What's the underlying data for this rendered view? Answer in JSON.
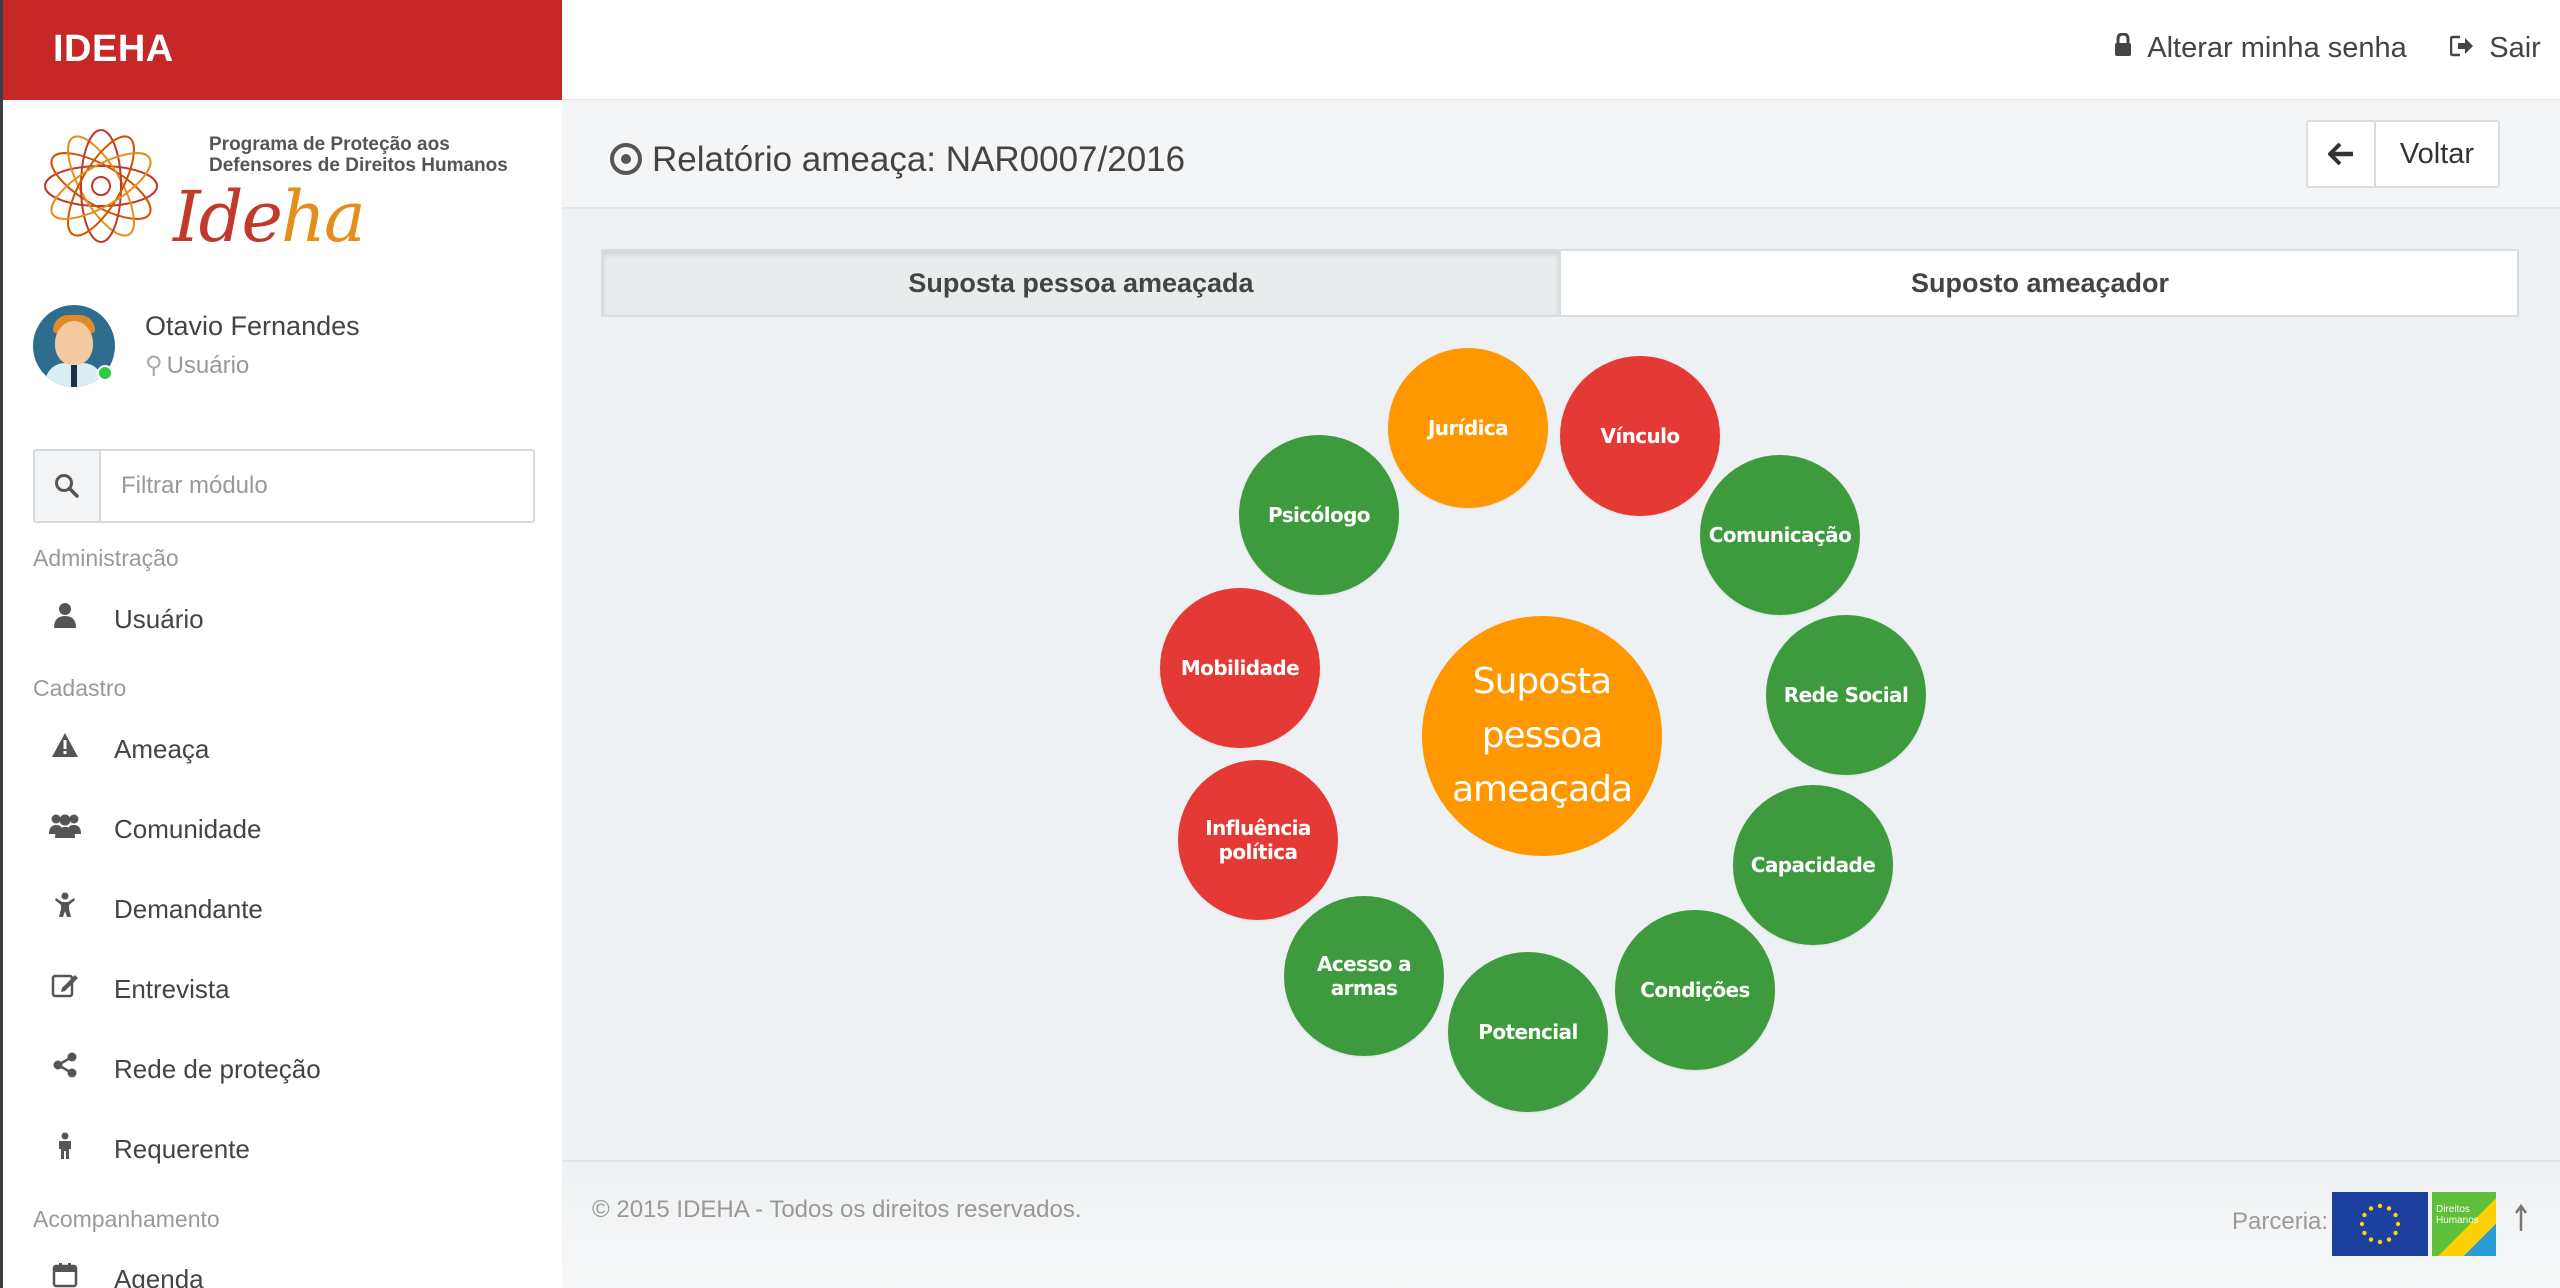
{
  "brand": "IDEHA",
  "logo": {
    "text": "Programa de Proteção aos Defensores de Direitos Humanos",
    "word_a": "Ide",
    "word_b": "ha"
  },
  "user": {
    "name": "Otavio Fernandes",
    "role": "Usuário"
  },
  "filter": {
    "placeholder": "Filtrar módulo"
  },
  "nav": {
    "sections": [
      "Administração",
      "Cadastro",
      "Acompanhamento"
    ],
    "items": [
      {
        "label": "Usuário",
        "icon": "user-icon"
      },
      {
        "label": "Ameaça",
        "icon": "warning-icon"
      },
      {
        "label": "Comunidade",
        "icon": "users-icon"
      },
      {
        "label": "Demandante",
        "icon": "child-icon"
      },
      {
        "label": "Entrevista",
        "icon": "edit-icon"
      },
      {
        "label": "Rede de proteção",
        "icon": "share-icon"
      },
      {
        "label": "Requerente",
        "icon": "male-icon"
      },
      {
        "label": "Agenda",
        "icon": "calendar-icon"
      }
    ]
  },
  "topbar": {
    "change_password": "Alterar minha senha",
    "logout": "Sair"
  },
  "header": {
    "title": "Relatório ameaça: NAR0007/2016",
    "back": "Voltar"
  },
  "tabs": [
    "Suposta pessoa ameaçada",
    "Suposto ameaçador"
  ],
  "diagram": {
    "center": "Suposta pessoa ameaçada",
    "colors": {
      "green": "#3d9b3d",
      "red": "#e53935",
      "orange": "#ff9800"
    },
    "nodes": [
      {
        "label": "Jurídica",
        "status": "orange"
      },
      {
        "label": "Vínculo",
        "status": "red"
      },
      {
        "label": "Comunicação",
        "status": "green"
      },
      {
        "label": "Rede Social",
        "status": "green"
      },
      {
        "label": "Capacidade",
        "status": "green"
      },
      {
        "label": "Condições",
        "status": "green"
      },
      {
        "label": "Potencial",
        "status": "green"
      },
      {
        "label": "Acesso a armas",
        "status": "green"
      },
      {
        "label": "Influência política",
        "status": "red"
      },
      {
        "label": "Mobilidade",
        "status": "red"
      },
      {
        "label": "Psicólogo",
        "status": "green"
      }
    ]
  },
  "footer": {
    "copyright": "© 2015 IDEHA - Todos os direitos reservados.",
    "partner": "Parceria:",
    "dh_logo": "Direitos Humanos"
  }
}
